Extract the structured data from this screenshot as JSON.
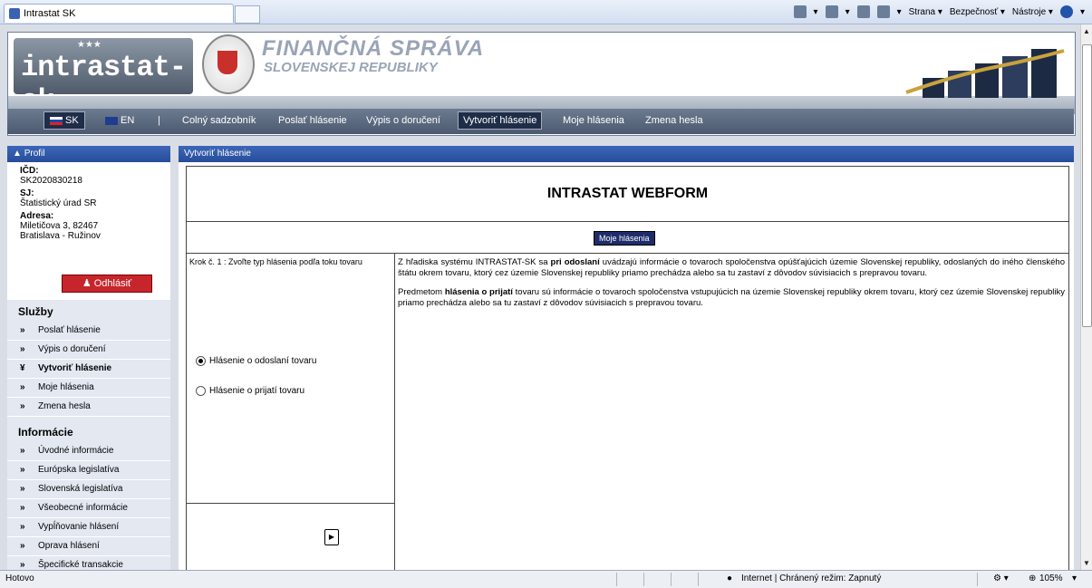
{
  "browser": {
    "tab_title": "Intrastat SK",
    "cmd": {
      "page": "Strana ▾",
      "security": "Bezpečnosť ▾",
      "tools": "Nástroje ▾",
      "help": "▾"
    }
  },
  "header": {
    "logo_text": "intrastat-sk",
    "org_line1": "FINANČNÁ SPRÁVA",
    "org_line2": "SLOVENSKEJ REPUBLIKY"
  },
  "nav": {
    "lang_sk": "SK",
    "lang_en": "EN",
    "separator": "|",
    "items": [
      "Colný sadzobník",
      "Poslať hlásenie",
      "Výpis o doručení",
      "Vytvoriť hlásenie",
      "Moje hlásenia",
      "Zmena hesla"
    ]
  },
  "profile": {
    "header": "Profil",
    "icd_label": "IČD:",
    "icd_value": "SK2020830218",
    "sj_label": "SJ:",
    "sj_value": "Štatistický úrad SR",
    "address_label": "Adresa:",
    "address_line1": "Miletičova 3, 82467",
    "address_line2": "Bratislava - Ružinov",
    "logout": "Odhlásiť"
  },
  "sidebar": {
    "services_title": "Služby",
    "services": [
      "Poslať hlásenie",
      "Výpis o doručení",
      "Vytvoriť hlásenie",
      "Moje hlásenia",
      "Zmena hesla"
    ],
    "info_title": "Informácie",
    "info": [
      "Úvodné informácie",
      "Európska legislatíva",
      "Slovenská legislatíva",
      "Všeobecné informácie",
      "Vypĺňovanie hlásení",
      "Oprava hlásení",
      "Špecifické transakcie"
    ]
  },
  "main": {
    "header": "Vytvoriť hlásenie",
    "title": "INTRASTAT WEBFORM",
    "moje_button": "Moje hlásenia",
    "step": "Krok č. 1 : Zvoľte typ hlásenia podľa toku tovaru",
    "radio_dispatch": "Hlásenie o odoslaní tovaru",
    "radio_arrival": "Hlásenie o prijatí tovaru",
    "p1_a": "Z hľadiska systému INTRASTAT-SK sa ",
    "p1_b": "pri odoslaní",
    "p1_c": " uvádzajú informácie o tovaroch spoločenstva opúšťajúcich územie Slovenskej republiky, odoslaných do iného členského štátu okrem tovaru, ktorý cez územie Slovenskej republiky priamo prechádza alebo sa tu zastaví z dôvodov súvisiacich s prepravou tovaru.",
    "p2_a": "Predmetom ",
    "p2_b": "hlásenia o prijatí",
    "p2_c": " tovaru sú informácie o tovaroch spoločenstva vstupujúcich na územie Slovenskej republiky okrem tovaru, ktorý cez územie Slovenskej republiky priamo prechádza alebo sa tu zastaví z dôvodov súvisiacich s prepravou tovaru."
  },
  "statusbar": {
    "left": "Hotovo",
    "zone": "Internet | Chránený režim: Zapnutý",
    "zoom": "105%"
  }
}
